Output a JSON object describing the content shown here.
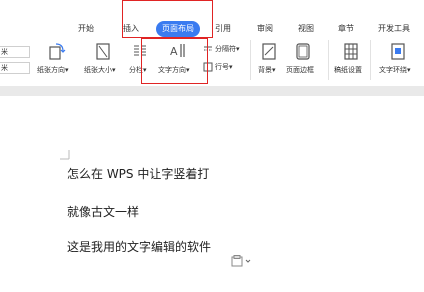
{
  "tabs": [
    {
      "label": "开始"
    },
    {
      "label": "插入"
    },
    {
      "label": "页面布局"
    },
    {
      "label": "引用"
    },
    {
      "label": "审阅"
    },
    {
      "label": "视图"
    },
    {
      "label": "章节"
    },
    {
      "label": "开发工具"
    }
  ],
  "ribbon": {
    "margin_top_value": "米",
    "margin_bottom_value": "米",
    "orientation": "纸张方向",
    "size": "纸张大小",
    "columns": "分栏",
    "text_direction": "文字方向",
    "separator": "分隔符",
    "line_numbers": "行号",
    "background": "背景",
    "page_border": "页面边框",
    "manuscript": "稿纸设置",
    "text_wrap": "文字环绕"
  },
  "document": {
    "lines": [
      "怎么在 WPS 中让字竖着打",
      "就像古文一样",
      "这是我用的文字编辑的软件"
    ]
  },
  "colors": {
    "active_tab": "#3a7bf0",
    "highlight_box": "#e02424"
  }
}
